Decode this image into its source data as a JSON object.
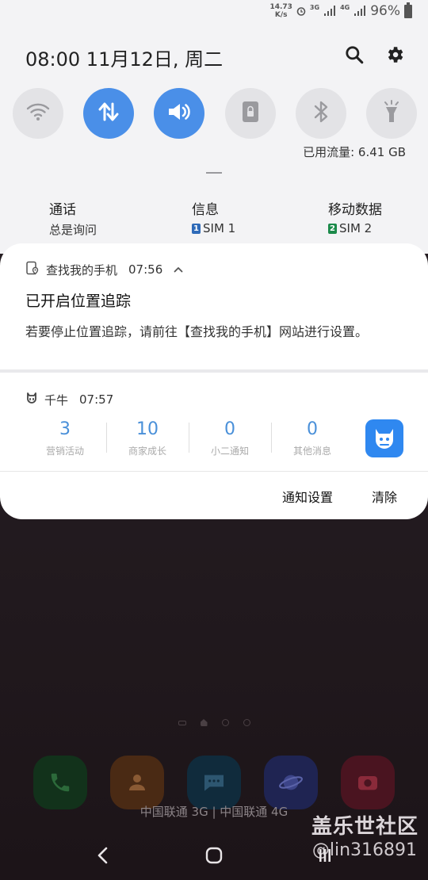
{
  "status_bar": {
    "net_speed_value": "14.73",
    "net_speed_unit": "K/s",
    "sim1_type": "3G",
    "sim2_type": "4G",
    "battery": "96%"
  },
  "header": {
    "time_date": "08:00  11月12日, 周二"
  },
  "quick_settings": [
    {
      "name": "wifi",
      "on": false
    },
    {
      "name": "mobile-data",
      "on": true
    },
    {
      "name": "sound",
      "on": true
    },
    {
      "name": "screen-lock",
      "on": false
    },
    {
      "name": "bluetooth",
      "on": false
    },
    {
      "name": "flashlight",
      "on": false
    }
  ],
  "data_usage": "已用流量: 6.41 GB",
  "sim_settings": {
    "call": {
      "title": "通话",
      "value": "总是询问"
    },
    "message": {
      "title": "信息",
      "badge": "1",
      "value": "SIM 1"
    },
    "mobile_data": {
      "title": "移动数据",
      "badge": "2",
      "value": "SIM 2"
    }
  },
  "notifications": {
    "find_my_phone": {
      "app": "查找我的手机",
      "time": "07:56",
      "title": "已开启位置追踪",
      "body": "若要停止位置追踪，请前往【查找我的手机】网站进行设置。"
    },
    "qianniu": {
      "app": "千牛",
      "time": "07:57",
      "stats": [
        {
          "value": "3",
          "label": "营销活动"
        },
        {
          "value": "10",
          "label": "商家成长"
        },
        {
          "value": "0",
          "label": "小二通知"
        },
        {
          "value": "0",
          "label": "其他消息"
        }
      ]
    }
  },
  "actions": {
    "notification_settings": "通知设置",
    "clear": "清除"
  },
  "carrier_text": "中国联通 3G | 中国联通 4G",
  "watermark": {
    "site": "盖乐世社区",
    "user": "@lin316891"
  },
  "colors": {
    "accent": "#4a8fe8",
    "stat_number": "#4a90d9",
    "sim1": "#2e6ab8",
    "sim2": "#1b8a4a"
  }
}
